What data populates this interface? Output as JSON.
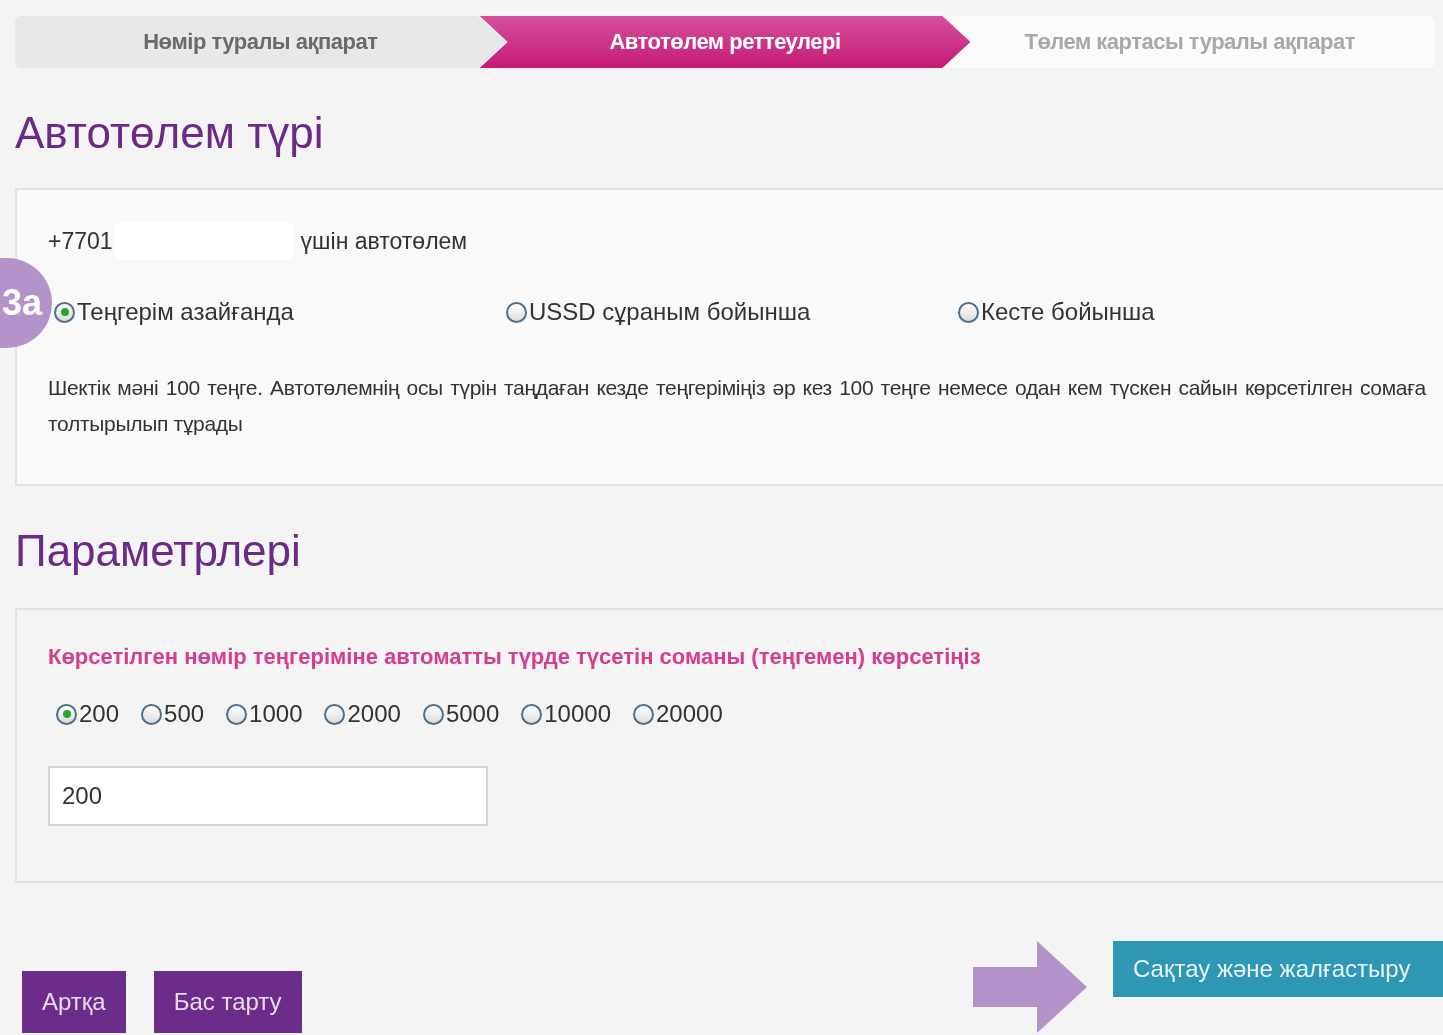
{
  "steps": [
    {
      "label": "Нөмір туралы ақпарат",
      "selected": false,
      "disabled": false
    },
    {
      "label": "Автотөлем реттеулері",
      "selected": true,
      "disabled": false
    },
    {
      "label": "Төлем картасы туралы ақпарат",
      "selected": false,
      "disabled": true
    }
  ],
  "type_section": {
    "title": "Автотөлем түрі",
    "number_prefix": "+7701",
    "number_suffix": "үшін автотөлем",
    "badge": "3a",
    "options": [
      {
        "label": "Теңгерім азайғанда",
        "selected": true
      },
      {
        "label": "USSD сұраным бойынша",
        "selected": false
      },
      {
        "label": "Кесте бойынша",
        "selected": false
      }
    ],
    "description": "Шектік мәні 100 теңге. Автотөлемнің осы түрін таңдаған кезде теңгеріміңіз әр кез 100 теңге немесе одан кем түскен сайын көрсетілген сомаға толтырылып тұрады"
  },
  "params_section": {
    "title": "Параметрлері",
    "prompt": "Көрсетілген нөмір теңгеріміне автоматты түрде түсетін соманы (теңгемен) көрсетіңіз",
    "amounts": [
      {
        "label": "200",
        "selected": true
      },
      {
        "label": "500",
        "selected": false
      },
      {
        "label": "1000",
        "selected": false
      },
      {
        "label": "2000",
        "selected": false
      },
      {
        "label": "5000",
        "selected": false
      },
      {
        "label": "10000",
        "selected": false
      },
      {
        "label": "20000",
        "selected": false
      }
    ],
    "amount_value": "200"
  },
  "buttons": [
    {
      "label": "Артқа",
      "kind": "secondary"
    },
    {
      "label": "Бас тарту",
      "kind": "secondary"
    },
    {
      "label": "Сақтау және жалғастыру",
      "kind": "primary"
    }
  ]
}
